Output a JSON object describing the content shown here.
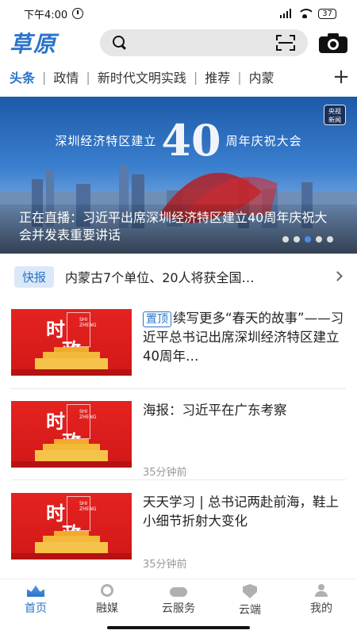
{
  "status_bar": {
    "time": "下午4:00",
    "battery": "37"
  },
  "header": {
    "logo": "草原",
    "search_placeholder": ""
  },
  "tabs": [
    {
      "label": "头条",
      "active": true
    },
    {
      "label": "政情",
      "active": false
    },
    {
      "label": "新时代文明实践",
      "active": false
    },
    {
      "label": "推荐",
      "active": false
    },
    {
      "label": "内蒙",
      "active": false
    }
  ],
  "tabs_add": "+",
  "banner": {
    "overlay_title_left": "深圳经济特区建立",
    "overlay_title_num": "40",
    "overlay_title_right": "周年庆祝大会",
    "badge": "央视\n新闻",
    "caption": "正在直播：习近平出席深圳经济特区建立40周年庆祝大会并发表重要讲话",
    "slide_count": 5,
    "active_slide": 2
  },
  "flash": {
    "badge": "快报",
    "text": "内蒙古7个单位、20人将获全国…"
  },
  "news": [
    {
      "thumb_text_1": "时",
      "thumb_text_2": "政",
      "thumb_pinyin": "SHI\nZHENG",
      "pinned_label": "置顶",
      "title": "续写更多“春天的故事”——习近平总书记出席深圳经济特区建立40周年…",
      "time": ""
    },
    {
      "thumb_text_1": "时",
      "thumb_text_2": "政",
      "thumb_pinyin": "SHI\nZHENG",
      "pinned_label": "",
      "title": "海报：习近平在广东考察",
      "time": "35分钟前"
    },
    {
      "thumb_text_1": "时",
      "thumb_text_2": "政",
      "thumb_pinyin": "SHI\nZHENG",
      "pinned_label": "",
      "title": "天天学习 | 总书记两赴前海，鞋上小细节折射大变化",
      "time": "35分钟前"
    }
  ],
  "bottom_nav": [
    {
      "label": "首页",
      "icon": "home-icon",
      "active": true
    },
    {
      "label": "融媒",
      "icon": "media-icon",
      "active": false
    },
    {
      "label": "云服务",
      "icon": "cloud-icon",
      "active": false
    },
    {
      "label": "云端",
      "icon": "shield-icon",
      "active": false
    },
    {
      "label": "我的",
      "icon": "user-icon",
      "active": false
    }
  ],
  "colors": {
    "accent": "#2a74c9",
    "thumb_red": "#e52320"
  }
}
